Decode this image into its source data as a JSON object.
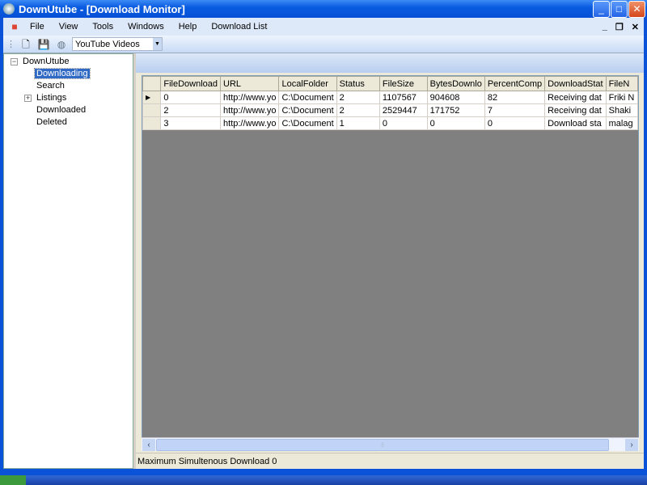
{
  "window": {
    "title": "DownUtube - [Download Monitor]",
    "minimize": "_",
    "maximize": "□",
    "close": "✕"
  },
  "mdi": {
    "minimize": "_",
    "restore": "❐",
    "close": "✕"
  },
  "menu": [
    "File",
    "View",
    "Tools",
    "Windows",
    "Help",
    "Download List"
  ],
  "toolbar": {
    "combo_value": "YouTube Videos"
  },
  "tree": {
    "root": "DownUtube",
    "items": [
      "Downloading",
      "Search",
      "Listings",
      "Downloaded",
      "Deleted"
    ],
    "selected": "Downloading"
  },
  "grid": {
    "columns": [
      "FileDownload",
      "URL",
      "LocalFolder",
      "Status",
      "FileSize",
      "BytesDownlo",
      "PercentComp",
      "DownloadStat",
      "FileN"
    ],
    "rows": [
      [
        "0",
        "http://www.yo",
        "C:\\Document",
        "2",
        "1107567",
        "904608",
        "82",
        "Receiving dat",
        "Friki N"
      ],
      [
        "2",
        "http://www.yo",
        "C:\\Document",
        "2",
        "2529447",
        "171752",
        "7",
        "Receiving dat",
        "Shaki"
      ],
      [
        "3",
        "http://www.yo",
        "C:\\Document",
        "1",
        "0",
        "0",
        "0",
        "Download sta",
        "malag"
      ]
    ],
    "current_row": 0
  },
  "status": {
    "text": "Maximum Simultenous Download 0"
  }
}
